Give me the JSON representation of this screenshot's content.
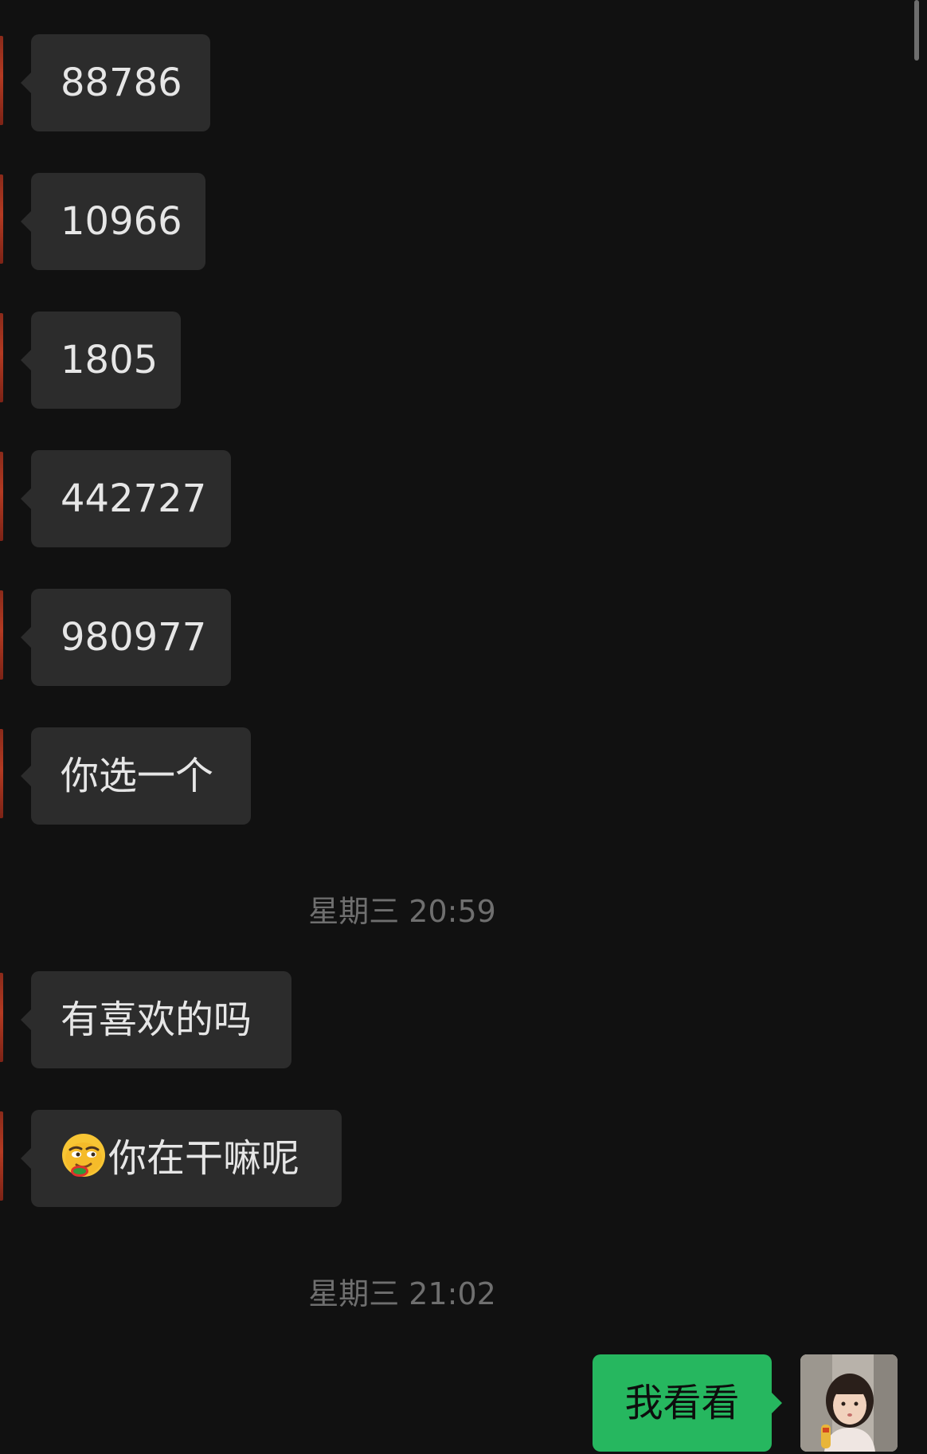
{
  "messages_in": [
    {
      "text": "88786"
    },
    {
      "text": "10966"
    },
    {
      "text": "1805"
    },
    {
      "text": "442727"
    },
    {
      "text": "980977"
    },
    {
      "text": "你选一个"
    },
    {
      "text": "有喜欢的吗"
    },
    {
      "text": "你在干嘛呢",
      "emoji": "smirking-face-emoji"
    }
  ],
  "timestamps": [
    "星期三 20:59",
    "星期三 21:02"
  ],
  "message_out": {
    "text": "我看看"
  },
  "colors": {
    "background": "#111111",
    "incoming_bubble": "#2c2c2c",
    "outgoing_bubble": "#26b75f",
    "incoming_text": "#e6e6e6",
    "timestamp_text": "#6f6f6f"
  }
}
